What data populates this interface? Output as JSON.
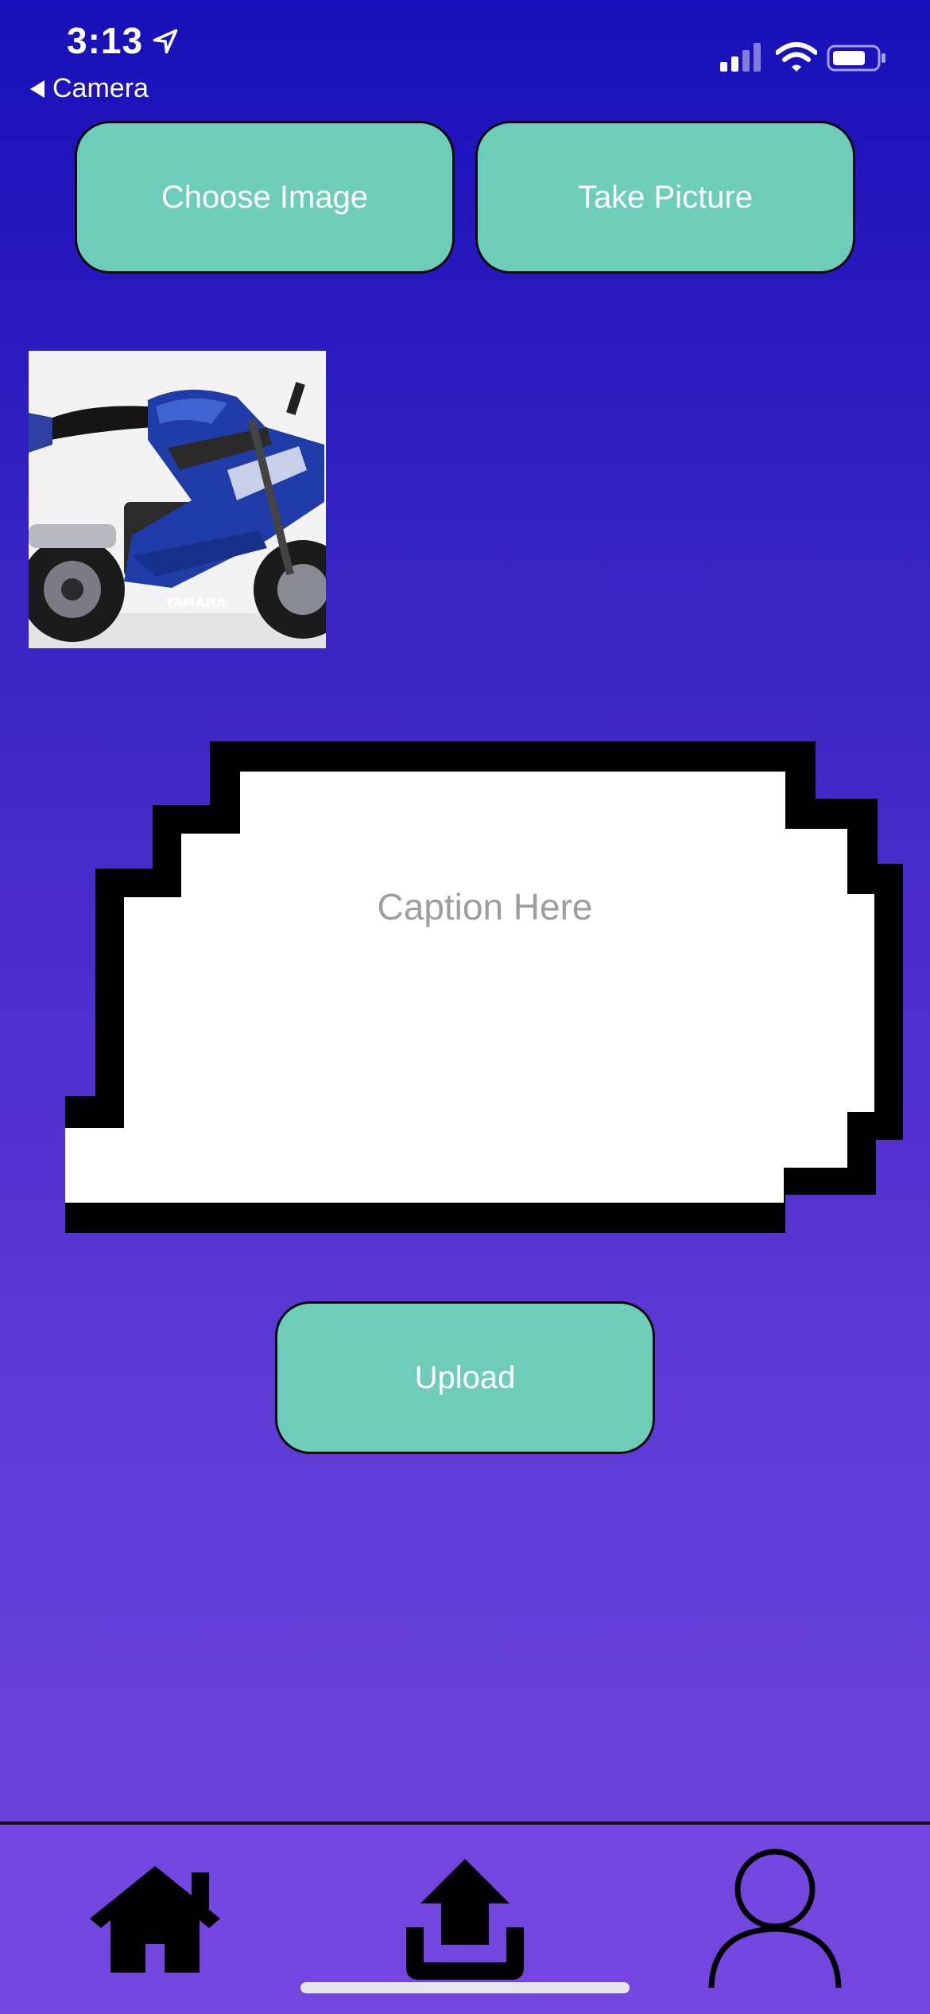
{
  "status_bar": {
    "time": "3:13",
    "back_label": "Camera",
    "icons": [
      "location-arrow-icon",
      "signal-icon",
      "wifi-icon",
      "battery-icon"
    ]
  },
  "actions": {
    "choose_image_label": "Choose Image",
    "take_picture_label": "Take Picture",
    "upload_label": "Upload"
  },
  "preview": {
    "brand_text": "YAMAHA"
  },
  "caption": {
    "placeholder": "Caption Here",
    "value": ""
  },
  "tab_bar": {
    "tabs": [
      "home-icon",
      "upload-icon",
      "profile-icon"
    ]
  },
  "colors": {
    "background_top": "#1710b8",
    "background_bottom": "#7347e0",
    "button": "#6dcdb8",
    "tab_bar": "#7446e0"
  }
}
